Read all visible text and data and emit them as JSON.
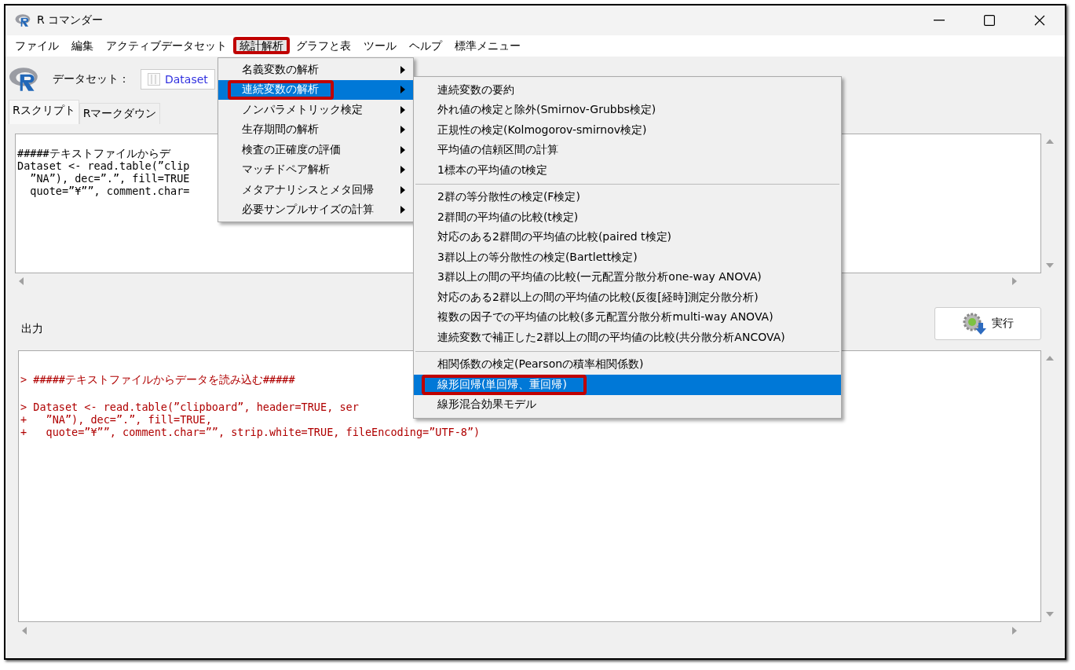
{
  "window": {
    "title": "R コマンダー"
  },
  "menu_bar": [
    {
      "label": "ファイル",
      "open": false
    },
    {
      "label": "編集",
      "open": false
    },
    {
      "label": "アクティブデータセット",
      "open": false
    },
    {
      "label": "統計解析",
      "open": true,
      "highlighted": true
    },
    {
      "label": "グラフと表",
      "open": false
    },
    {
      "label": "ツール",
      "open": false
    },
    {
      "label": "ヘルプ",
      "open": false
    },
    {
      "label": "標準メニュー",
      "open": false
    }
  ],
  "toolbar": {
    "dataset_label": "データセット：",
    "dataset_button": "Dataset"
  },
  "tabs": [
    {
      "label": "Rスクリプト",
      "selected": true
    },
    {
      "label": "Rマークダウン",
      "selected": false
    }
  ],
  "script_lines": [
    "#####テキストファイルからデ",
    "Dataset <- read.table(”clip",
    "  ”NA”), dec=”.”, fill=TRUE",
    "  quote=”¥””, comment.char="
  ],
  "output_label": "出力",
  "run_button": "実行",
  "output_blocks": [
    {
      "lines": [
        "> #####テキストファイルからデータを読み込む#####"
      ]
    },
    {
      "lines": [
        "> Dataset <- read.table(”clipboard”, header=TRUE, ser",
        "+   ”NA”), dec=”.”, fill=TRUE,",
        "+   quote=”¥””, comment.char=””, strip.white=TRUE, fileEncoding=”UTF-8”)"
      ]
    }
  ],
  "stat_menu": [
    {
      "label": "名義変数の解析",
      "selected": false,
      "highlighted": false
    },
    {
      "label": "連続変数の解析",
      "selected": true,
      "highlighted": true
    },
    {
      "label": "ノンパラメトリック検定",
      "selected": false,
      "highlighted": false
    },
    {
      "label": "生存期間の解析",
      "selected": false,
      "highlighted": false
    },
    {
      "label": "検査の正確度の評価",
      "selected": false,
      "highlighted": false
    },
    {
      "label": "マッチドペア解析",
      "selected": false,
      "highlighted": false
    },
    {
      "label": "メタアナリシスとメタ回帰",
      "selected": false,
      "highlighted": false
    },
    {
      "label": "必要サンプルサイズの計算",
      "selected": false,
      "highlighted": false
    }
  ],
  "submenu": [
    {
      "kind": "item",
      "label": "連続変数の要約",
      "selected": false,
      "highlighted": false
    },
    {
      "kind": "item",
      "label": "外れ値の検定と除外(Smirnov-Grubbs検定)",
      "selected": false,
      "highlighted": false
    },
    {
      "kind": "item",
      "label": "正規性の検定(Kolmogorov-smirnov検定)",
      "selected": false,
      "highlighted": false
    },
    {
      "kind": "item",
      "label": "平均値の信頼区間の計算",
      "selected": false,
      "highlighted": false
    },
    {
      "kind": "item",
      "label": "1標本の平均値のt検定",
      "selected": false,
      "highlighted": false
    },
    {
      "kind": "separator"
    },
    {
      "kind": "item",
      "label": "2群の等分散性の検定(F検定)",
      "selected": false,
      "highlighted": false
    },
    {
      "kind": "item",
      "label": "2群間の平均値の比較(t検定)",
      "selected": false,
      "highlighted": false
    },
    {
      "kind": "item",
      "label": "対応のある2群間の平均値の比較(paired t検定)",
      "selected": false,
      "highlighted": false
    },
    {
      "kind": "item",
      "label": "3群以上の等分散性の検定(Bartlett検定)",
      "selected": false,
      "highlighted": false
    },
    {
      "kind": "item",
      "label": "3群以上の間の平均値の比較(一元配置分散分析one-way ANOVA)",
      "selected": false,
      "highlighted": false
    },
    {
      "kind": "item",
      "label": "対応のある2群以上の間の平均値の比較(反復[経時]測定分散分析)",
      "selected": false,
      "highlighted": false
    },
    {
      "kind": "item",
      "label": "複数の因子での平均値の比較(多元配置分散分析multi-way ANOVA)",
      "selected": false,
      "highlighted": false
    },
    {
      "kind": "item",
      "label": "連続変数で補正した2群以上の間の平均値の比較(共分散分析ANCOVA)",
      "selected": false,
      "highlighted": false
    },
    {
      "kind": "separator"
    },
    {
      "kind": "item",
      "label": "相関係数の検定(Pearsonの積率相関係数)",
      "selected": false,
      "highlighted": false
    },
    {
      "kind": "item",
      "label": "線形回帰(単回帰、重回帰)",
      "selected": true,
      "highlighted": true
    },
    {
      "kind": "item",
      "label": "線形混合効果モデル",
      "selected": false,
      "highlighted": false
    }
  ]
}
